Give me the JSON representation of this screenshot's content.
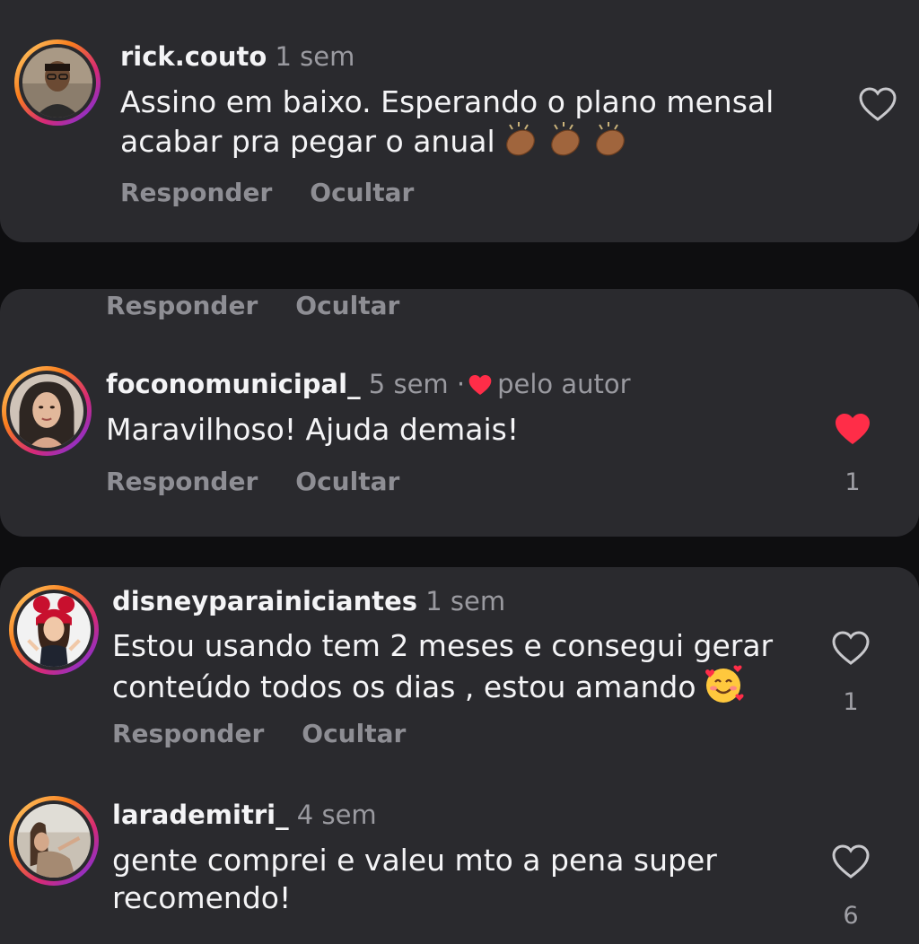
{
  "comments": [
    {
      "username": "rick.couto",
      "time": "1 sem",
      "text_lines": [
        "Assino em baixo. Esperando o plano mensal",
        "acabar pra pegar o anual"
      ],
      "emoji": "clapping-hands",
      "reply_label": "Responder",
      "hide_label": "Ocultar",
      "liked": false,
      "like_count": ""
    },
    {
      "username": "foconomunicipal_",
      "time": "5 sem",
      "separator": "·",
      "author_badge": "pelo autor",
      "text_lines": [
        "Maravilhoso! Ajuda demais!"
      ],
      "reply_label": "Responder",
      "hide_label": "Ocultar",
      "liked": true,
      "like_count": "1"
    },
    {
      "username": "disneyparainiciantes",
      "time": "1 sem",
      "text_lines": [
        "Estou usando tem 2 meses e consegui gerar",
        "conteúdo todos os dias , estou amando"
      ],
      "emoji": "smiling-face-with-hearts",
      "reply_label": "Responder",
      "hide_label": "Ocultar",
      "liked": false,
      "like_count": "1"
    },
    {
      "username": "larademitri_",
      "time": "4 sem",
      "text_lines": [
        "gente comprei e valeu mto a pena super",
        "recomendo!"
      ],
      "liked": false,
      "like_count": "6"
    }
  ],
  "orphan_actions": {
    "reply_label": "Responder",
    "hide_label": "Ocultar"
  },
  "colors": {
    "card_bg": "#2a2a2e",
    "page_bg": "#0e0e10",
    "like_red": "#ff2d48",
    "muted_text": "#8e8e94"
  }
}
